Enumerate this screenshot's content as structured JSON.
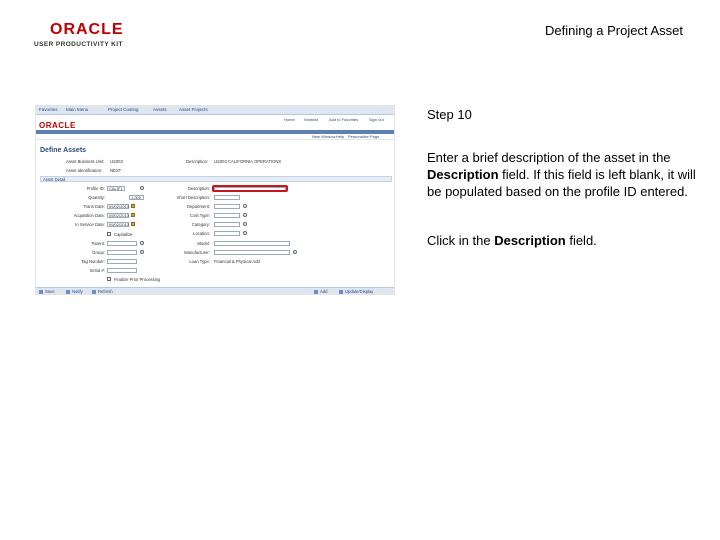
{
  "header": {
    "logo_brand": "ORACLE",
    "logo_tagline": "USER PRODUCTIVITY KIT",
    "doc_title": "Defining a Project Asset"
  },
  "screenshot": {
    "nav_items": [
      "Favorites",
      "Main Menu",
      "Project Costing",
      "Assets",
      "Asset Projects"
    ],
    "brand": "ORACLE",
    "top_links": [
      "Home",
      "Worklist",
      "Add to Favorites",
      "Sign out"
    ],
    "sub_links": [
      "New Window",
      "Help",
      "Personalize Page"
    ],
    "page_title": "Define Assets",
    "business_unit_label": "Asset Business Unit:",
    "business_unit_value": "US003",
    "asset_id_label": "Asset Identification:",
    "asset_id_value": "NEXT",
    "description_label": "Description:",
    "description_value": "US003 CALIFORNIA OPERATIONS",
    "section_label": "Asset Detail",
    "left_fields": [
      {
        "label": "Profile ID:",
        "value": "CALIF1"
      },
      {
        "label": "Quantity:",
        "value": "1.000"
      },
      {
        "label": "Trans Date:",
        "value": "09/02/2013"
      },
      {
        "label": "Acquisition Date:",
        "value": "09/02/2013"
      },
      {
        "label": "In Service Date:",
        "value": "09/02/2013"
      }
    ],
    "capitalize_label": "Capitalize",
    "left_fields2": [
      {
        "label": "Parent:",
        "value": ""
      },
      {
        "label": "Group:",
        "value": ""
      },
      {
        "label": "Tag Number:",
        "value": ""
      },
      {
        "label": "Serial #:",
        "value": ""
      }
    ],
    "pending_label": "Finalize Prior Processing",
    "right_fields": [
      {
        "label": "Description:"
      },
      {
        "label": "Short Description:"
      },
      {
        "label": "Department:"
      },
      {
        "label": "Cost Type:"
      },
      {
        "label": "Category:"
      },
      {
        "label": "Location:"
      },
      {
        "label": "Model:"
      },
      {
        "label": "Manufacturer:"
      }
    ],
    "loan_type_label": "Loan Type:",
    "loan_type_value": "Financial & Physical Add",
    "bottom_left": [
      "Save",
      "Notify",
      "Refresh"
    ],
    "bottom_right": [
      "Add",
      "Update/Display"
    ]
  },
  "instructions": {
    "step": "Step 10",
    "p1_a": "Enter a brief description of the asset in the ",
    "p1_b": "Description",
    "p1_c": " field. If this field is left blank, it will be populated based on the profile ID entered.",
    "p2_a": "Click in the ",
    "p2_b": "Description",
    "p2_c": " field."
  }
}
